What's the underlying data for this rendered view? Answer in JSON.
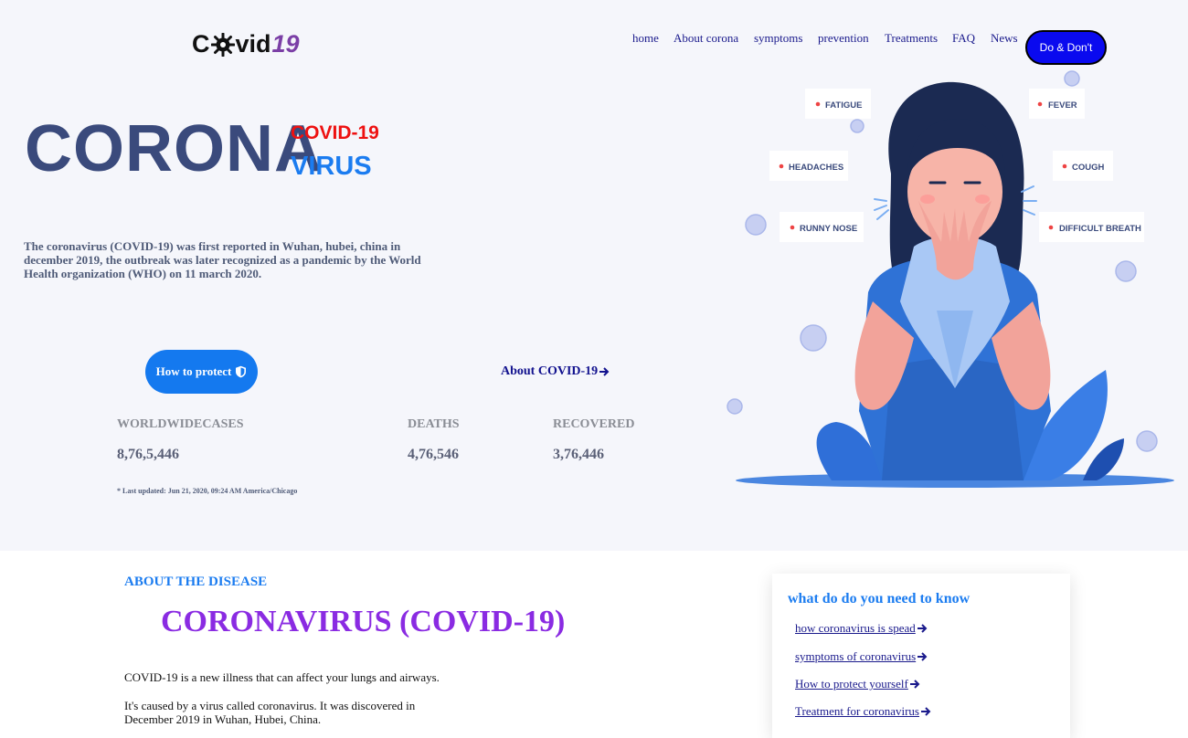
{
  "logo": {
    "prefix": "C",
    "suffix": "vid",
    "number": "19"
  },
  "nav": {
    "items": [
      "home",
      "About corona",
      "symptoms",
      "prevention",
      "Treatments",
      "FAQ",
      "News"
    ],
    "cta": "Do & Don't"
  },
  "hero": {
    "title": "CORONA",
    "tag_top": "COVID-19",
    "tag_bottom": "VIRUS",
    "intro": "The coronavirus (COVID-19) was first reported in Wuhan, hubei, china in december 2019, the outbreak was later recognized as a pandemic by the World Health organization (WHO) on 11 march 2020.",
    "protect_button": "How to protect",
    "about_link": "About COVID-19"
  },
  "stats": {
    "worldwide_label": "WORLDWIDECASES",
    "worldwide_value": "8,76,5,446",
    "deaths_label": "DEATHS",
    "deaths_value": "4,76,546",
    "recovered_label": "RECOVERED",
    "recovered_value": "3,76,446",
    "updated": "* Last updated: Jun 21, 2020, 09:24 AM America/Chicago"
  },
  "illustration": {
    "symptoms": [
      "FATIGUE",
      "FEVER",
      "HEADACHES",
      "COUGH",
      "RUNNY NOSE",
      "DIFFICULT BREATH"
    ]
  },
  "about": {
    "label": "ABOUT THE DISEASE",
    "title": "CORONAVIRUS (COVID-19)",
    "para1": "COVID-19 is a new illness that can affect your lungs and airways.",
    "para2_line1": "It's caused by a virus called coronavirus. It was discovered in",
    "para2_line2": "December 2019 in Wuhan, Hubei, China."
  },
  "know": {
    "title": "what do do you need to know",
    "links": [
      "how coronavirus is spead ",
      "symptoms of coronavirus ",
      "How to protect yourself",
      "Treatment for coronavirus"
    ]
  },
  "colors": {
    "navy": "#3a4a7c",
    "blue": "#1b7cf0",
    "red": "#ee1111",
    "purple": "#8a2be2",
    "cta": "#0a0aef"
  }
}
